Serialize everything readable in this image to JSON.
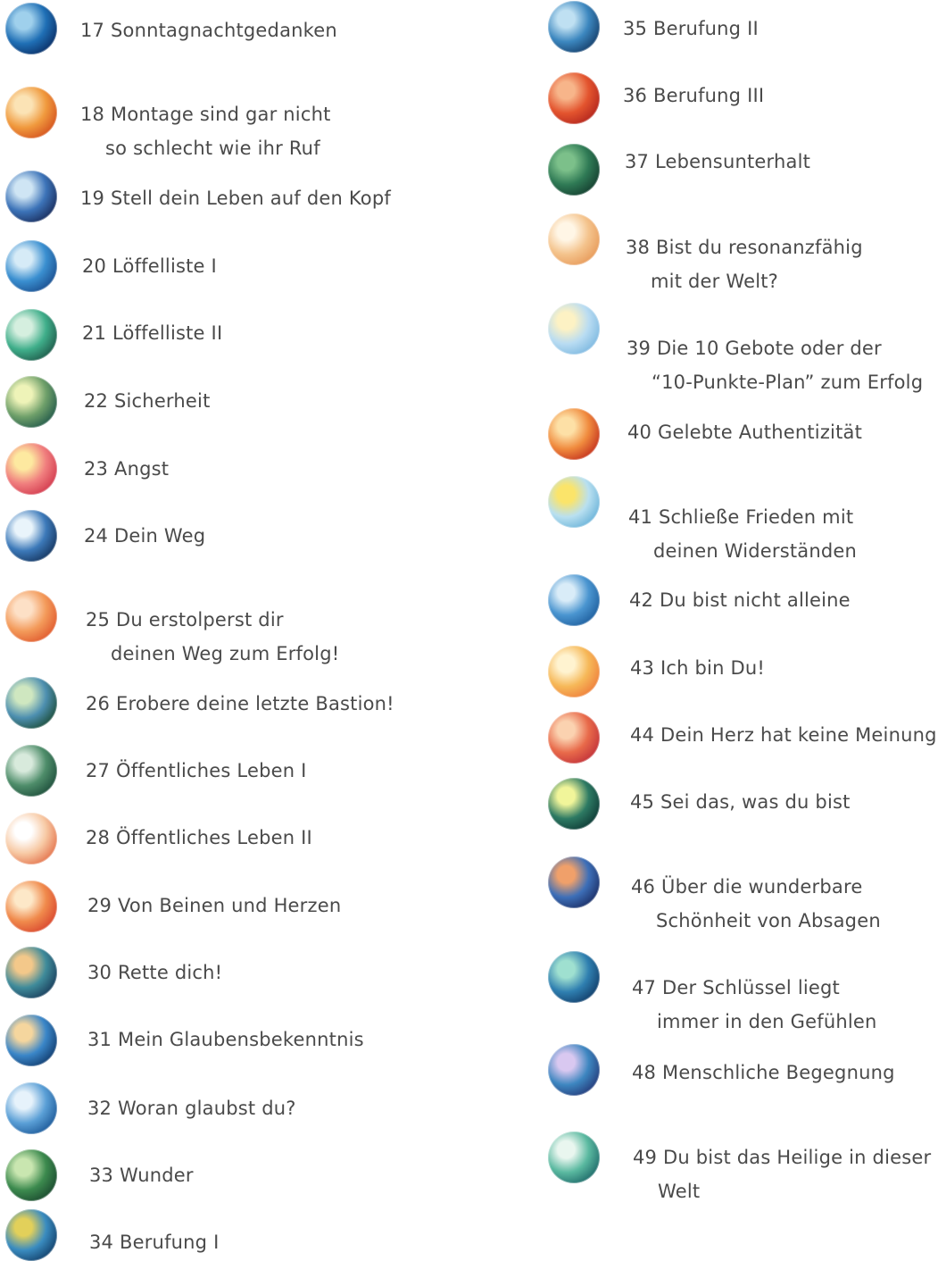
{
  "chapters_left": [
    {
      "title": "17 Sonntagnachtgedanken",
      "cont": "",
      "icon": "watercolor-circle-icon",
      "c1": "#9fd0ec",
      "c2": "#1f6fb5",
      "c3": "#0b2f66"
    },
    {
      "title": "18 Montage sind gar nicht",
      "cont": "so schlecht wie ihr Ruf",
      "icon": "watercolor-circle-icon",
      "c1": "#fbe3b5",
      "c2": "#f09a3e",
      "c3": "#d4521e"
    },
    {
      "title": "19 Stell dein Leben auf den Kopf",
      "cont": "",
      "icon": "watercolor-circle-icon",
      "c1": "#cfe5f4",
      "c2": "#3c73b8",
      "c3": "#1a2d5c"
    },
    {
      "title": "20 Löffelliste I",
      "cont": "",
      "icon": "watercolor-circle-icon",
      "c1": "#d6ebf7",
      "c2": "#3a8fd0",
      "c3": "#1b4f8f"
    },
    {
      "title": "21 Löffelliste II",
      "cont": "",
      "icon": "watercolor-circle-icon",
      "c1": "#d5efdf",
      "c2": "#3fae8a",
      "c3": "#1f5a4a"
    },
    {
      "title": "22 Sicherheit",
      "cont": "",
      "icon": "watercolor-circle-icon",
      "c1": "#eef3b8",
      "c2": "#6fa06a",
      "c3": "#235a4a"
    },
    {
      "title": "23 Angst",
      "cont": "",
      "icon": "watercolor-circle-icon",
      "c1": "#fde9a0",
      "c2": "#f07e7e",
      "c3": "#d23a4e"
    },
    {
      "title": "24 Dein Weg",
      "cont": "",
      "icon": "watercolor-circle-icon",
      "c1": "#e9f4fb",
      "c2": "#3c79b9",
      "c3": "#16365f"
    },
    {
      "title": "25 Du erstolperst dir",
      "cont": "deinen Weg zum Erfolg!",
      "icon": "watercolor-circle-icon",
      "c1": "#fde0c6",
      "c2": "#f39a5a",
      "c3": "#e05a2e"
    },
    {
      "title": "26 Erobere deine letzte Bastion!",
      "cont": "",
      "icon": "watercolor-circle-icon",
      "c1": "#cfe7c0",
      "c2": "#4d8fb0",
      "c3": "#1d4e3b"
    },
    {
      "title": "27 Öffentliches Leben I",
      "cont": "",
      "icon": "watercolor-circle-icon",
      "c1": "#d8eadc",
      "c2": "#4e8d6a",
      "c3": "#1f4f3c"
    },
    {
      "title": "28 Öffentliches Leben II",
      "cont": "",
      "icon": "watercolor-circle-icon",
      "c1": "#ffffff",
      "c2": "#f7c9a4",
      "c3": "#e4734c"
    },
    {
      "title": "29 Von Beinen und Herzen",
      "cont": "",
      "icon": "watercolor-circle-icon",
      "c1": "#fde8c8",
      "c2": "#f08a4c",
      "c3": "#d9472f"
    },
    {
      "title": "30 Rette dich!",
      "cont": "",
      "icon": "watercolor-circle-icon",
      "c1": "#f3c88a",
      "c2": "#3f8b9a",
      "c3": "#1a3e5c"
    },
    {
      "title": "31 Mein Glaubensbekenntnis",
      "cont": "",
      "icon": "watercolor-circle-icon",
      "c1": "#f5d69e",
      "c2": "#3a86c8",
      "c3": "#123d6f"
    },
    {
      "title": "32 Woran glaubst du?",
      "cont": "",
      "icon": "watercolor-circle-icon",
      "c1": "#e6f2fb",
      "c2": "#5a9fd6",
      "c3": "#1e5a99"
    },
    {
      "title": "33 Wunder",
      "cont": "",
      "icon": "watercolor-circle-icon",
      "c1": "#c9e6b0",
      "c2": "#3c8a4e",
      "c3": "#1b4a2f"
    },
    {
      "title": "34 Berufung I",
      "cont": "",
      "icon": "watercolor-circle-icon",
      "c1": "#e2d05a",
      "c2": "#3a8cc0",
      "c3": "#13406a"
    }
  ],
  "chapters_right": [
    {
      "title": "35 Berufung II",
      "cont": "",
      "icon": "watercolor-circle-icon",
      "c1": "#bfe0f2",
      "c2": "#3c87bf",
      "c3": "#163f6b"
    },
    {
      "title": "36 Berufung III",
      "cont": "",
      "icon": "watercolor-circle-icon",
      "c1": "#f7b58a",
      "c2": "#e3542e",
      "c3": "#b3261e"
    },
    {
      "title": "37 Lebensunterhalt",
      "cont": "",
      "icon": "watercolor-circle-icon",
      "c1": "#7cc08a",
      "c2": "#2f7a55",
      "c3": "#153f30"
    },
    {
      "title": "38 Bist du resonanzfähig",
      "cont": "mit der Welt?",
      "icon": "watercolor-circle-icon",
      "c1": "#fff6e6",
      "c2": "#f4c38c",
      "c3": "#e79a5a"
    },
    {
      "title": "39 Die 10 Gebote oder der",
      "cont": "“10-Punkte-Plan” zum Erfolg",
      "icon": "watercolor-circle-icon",
      "c1": "#fdf2c4",
      "c2": "#b9dcf2",
      "c3": "#7db8e0"
    },
    {
      "title": "40 Gelebte Authentizität",
      "cont": "",
      "icon": "watercolor-circle-icon",
      "c1": "#fde0a6",
      "c2": "#f08b3e",
      "c3": "#c4321e"
    },
    {
      "title": "41 Schließe Frieden mit",
      "cont": "deinen Widerständen",
      "icon": "watercolor-circle-icon",
      "c1": "#fbe46a",
      "c2": "#b9e0f0",
      "c3": "#6bb3d9"
    },
    {
      "title": "42 Du bist nicht alleine",
      "cont": "",
      "icon": "watercolor-circle-icon",
      "c1": "#d9ecf8",
      "c2": "#4a95d0",
      "c3": "#1f5f9e"
    },
    {
      "title": "43 Ich bin Du!",
      "cont": "",
      "icon": "watercolor-circle-icon",
      "c1": "#fff3d0",
      "c2": "#f6b858",
      "c3": "#ef7f3c"
    },
    {
      "title": "44 Dein Herz hat keine Meinung",
      "cont": "",
      "icon": "watercolor-circle-icon",
      "c1": "#fbd2b0",
      "c2": "#e86a4a",
      "c3": "#c2323a"
    },
    {
      "title": "45 Sei das, was du bist",
      "cont": "",
      "icon": "watercolor-circle-icon",
      "c1": "#f1f59a",
      "c2": "#2d7a63",
      "c3": "#0f3b36"
    },
    {
      "title": "46 Über die wunderbare",
      "cont": "Schönheit von Absagen",
      "icon": "watercolor-circle-icon",
      "c1": "#f0a06a",
      "c2": "#3d6fb8",
      "c3": "#1c2f66"
    },
    {
      "title": "47 Der Schlüssel liegt",
      "cont": "immer in den Gefühlen",
      "icon": "watercolor-circle-icon",
      "c1": "#9fe0d0",
      "c2": "#2f7fb0",
      "c3": "#123e6a"
    },
    {
      "title": "48 Menschliche Begegnung",
      "cont": "",
      "icon": "watercolor-circle-icon",
      "c1": "#d9c8f0",
      "c2": "#3d86c0",
      "c3": "#253b7a"
    },
    {
      "title": "49 Du bist das Heilige in dieser",
      "cont": "Welt",
      "icon": "watercolor-circle-icon",
      "c1": "#e9f6ef",
      "c2": "#5ab9a0",
      "c3": "#1f6a6a"
    }
  ]
}
